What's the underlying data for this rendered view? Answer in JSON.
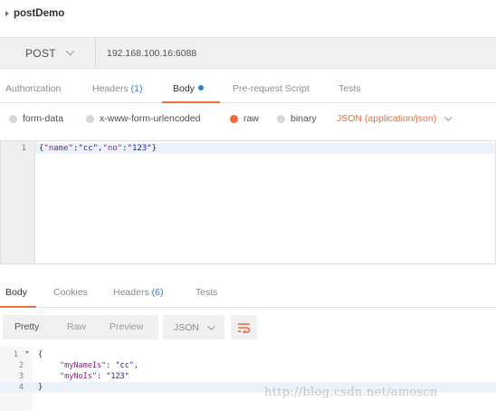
{
  "breadcrumb": {
    "collection": "postDemo"
  },
  "request": {
    "method": "POST",
    "url": "192.168.100.16:6088"
  },
  "request_tabs": [
    {
      "label": "Authorization"
    },
    {
      "label": "Headers",
      "count": "(1)"
    },
    {
      "label": "Body",
      "active": true
    },
    {
      "label": "Pre-request Script"
    },
    {
      "label": "Tests"
    }
  ],
  "body_options": {
    "modes": [
      "form-data",
      "x-www-form-urlencoded",
      "raw",
      "binary"
    ],
    "selected": "raw",
    "content_type": "JSON (application/json)"
  },
  "request_body": {
    "line_numbers": [
      "1"
    ],
    "code": [
      {
        "open": "{",
        "k1": "\"name\"",
        "c1": ":",
        "v1": "\"cc\"",
        "sep": ",",
        "k2": "\"no\"",
        "c2": ":",
        "v2": "\"123\"",
        "close": "}"
      }
    ]
  },
  "response_tabs": [
    {
      "label": "Body",
      "active": true
    },
    {
      "label": "Cookies"
    },
    {
      "label": "Headers",
      "count": "(6)"
    },
    {
      "label": "Tests"
    }
  ],
  "response_view": {
    "modes": [
      "Pretty",
      "Raw",
      "Preview"
    ],
    "selected": "Pretty",
    "format": "JSON"
  },
  "response_body": {
    "line_numbers": [
      "1",
      "2",
      "3",
      "4"
    ],
    "lines": [
      {
        "text": "{"
      },
      {
        "key": "\"myNameIs\"",
        "sep": ": ",
        "value": "\"cc\"",
        "tail": ","
      },
      {
        "key": "\"myNoIs\"",
        "sep": ": ",
        "value": "\"123\"",
        "tail": ""
      },
      {
        "text": "}"
      }
    ]
  },
  "watermark": "http://blog.csdn.net/amoscn",
  "colors": {
    "accent": "#f26b3a",
    "link": "#2d7fd6",
    "json_key": "#a31590",
    "json_value": "#1a1aa6"
  }
}
